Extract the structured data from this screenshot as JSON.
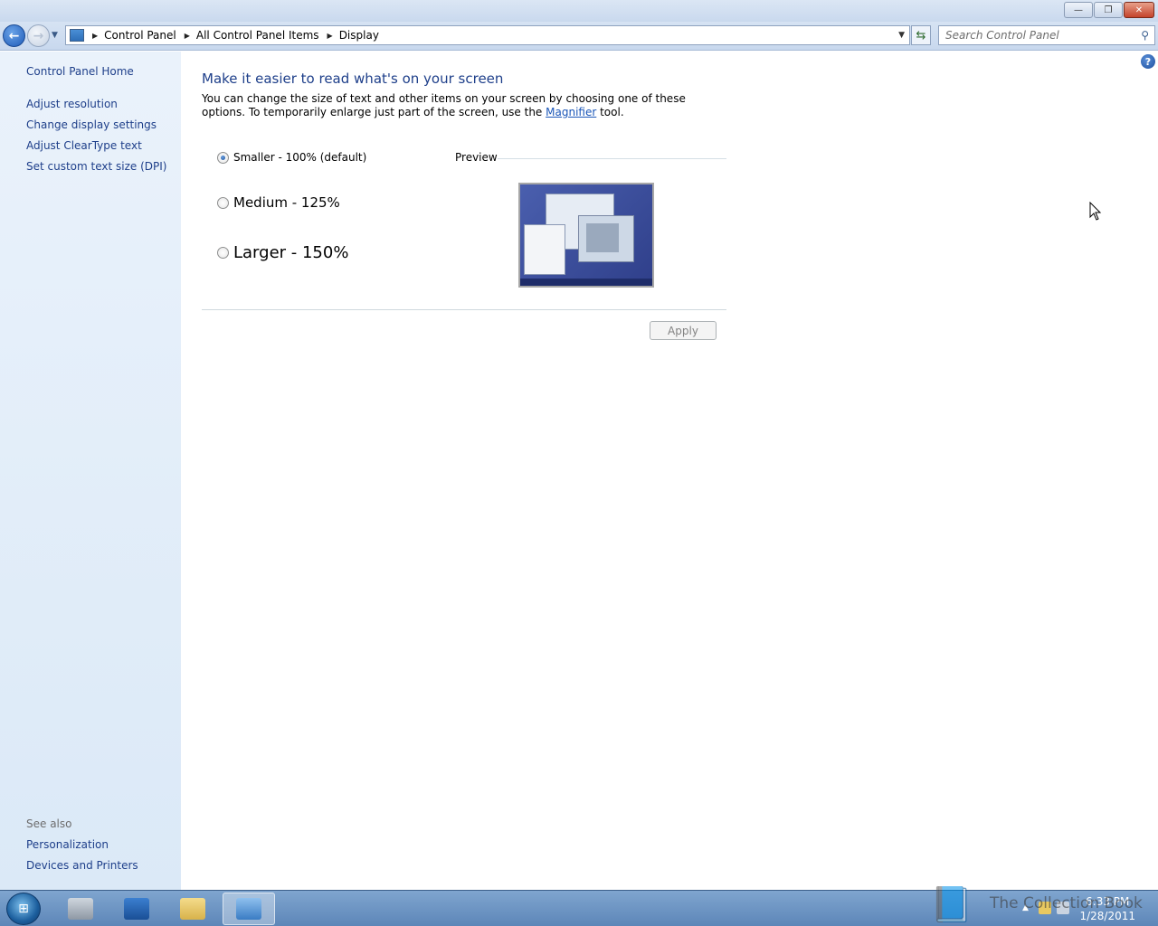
{
  "window": {
    "minimize_glyph": "—",
    "restore_glyph": "❐",
    "close_glyph": "✕"
  },
  "nav": {
    "breadcrumbs": [
      "Control Panel",
      "All Control Panel Items",
      "Display"
    ],
    "search_placeholder": "Search Control Panel"
  },
  "sidebar": {
    "home": "Control Panel Home",
    "links": [
      "Adjust resolution",
      "Change display settings",
      "Adjust ClearType text",
      "Set custom text size (DPI)"
    ],
    "see_also_heading": "See also",
    "see_also": [
      "Personalization",
      "Devices and Printers"
    ]
  },
  "main": {
    "title": "Make it easier to read what's on your screen",
    "desc_before": "You can change the size of text and other items on your screen by choosing one of these options. To temporarily enlarge just part of the screen, use the ",
    "desc_link": "Magnifier",
    "desc_after": " tool.",
    "options": [
      {
        "label": "Smaller - 100% (default)",
        "checked": true
      },
      {
        "label": "Medium - 125%",
        "checked": false
      },
      {
        "label": "Larger - 150%",
        "checked": false
      }
    ],
    "preview_label": "Preview",
    "apply_label": "Apply"
  },
  "taskbar": {
    "time": "6:33 PM",
    "date": "1/28/2011"
  },
  "watermark": {
    "text": "The Collection Book"
  }
}
